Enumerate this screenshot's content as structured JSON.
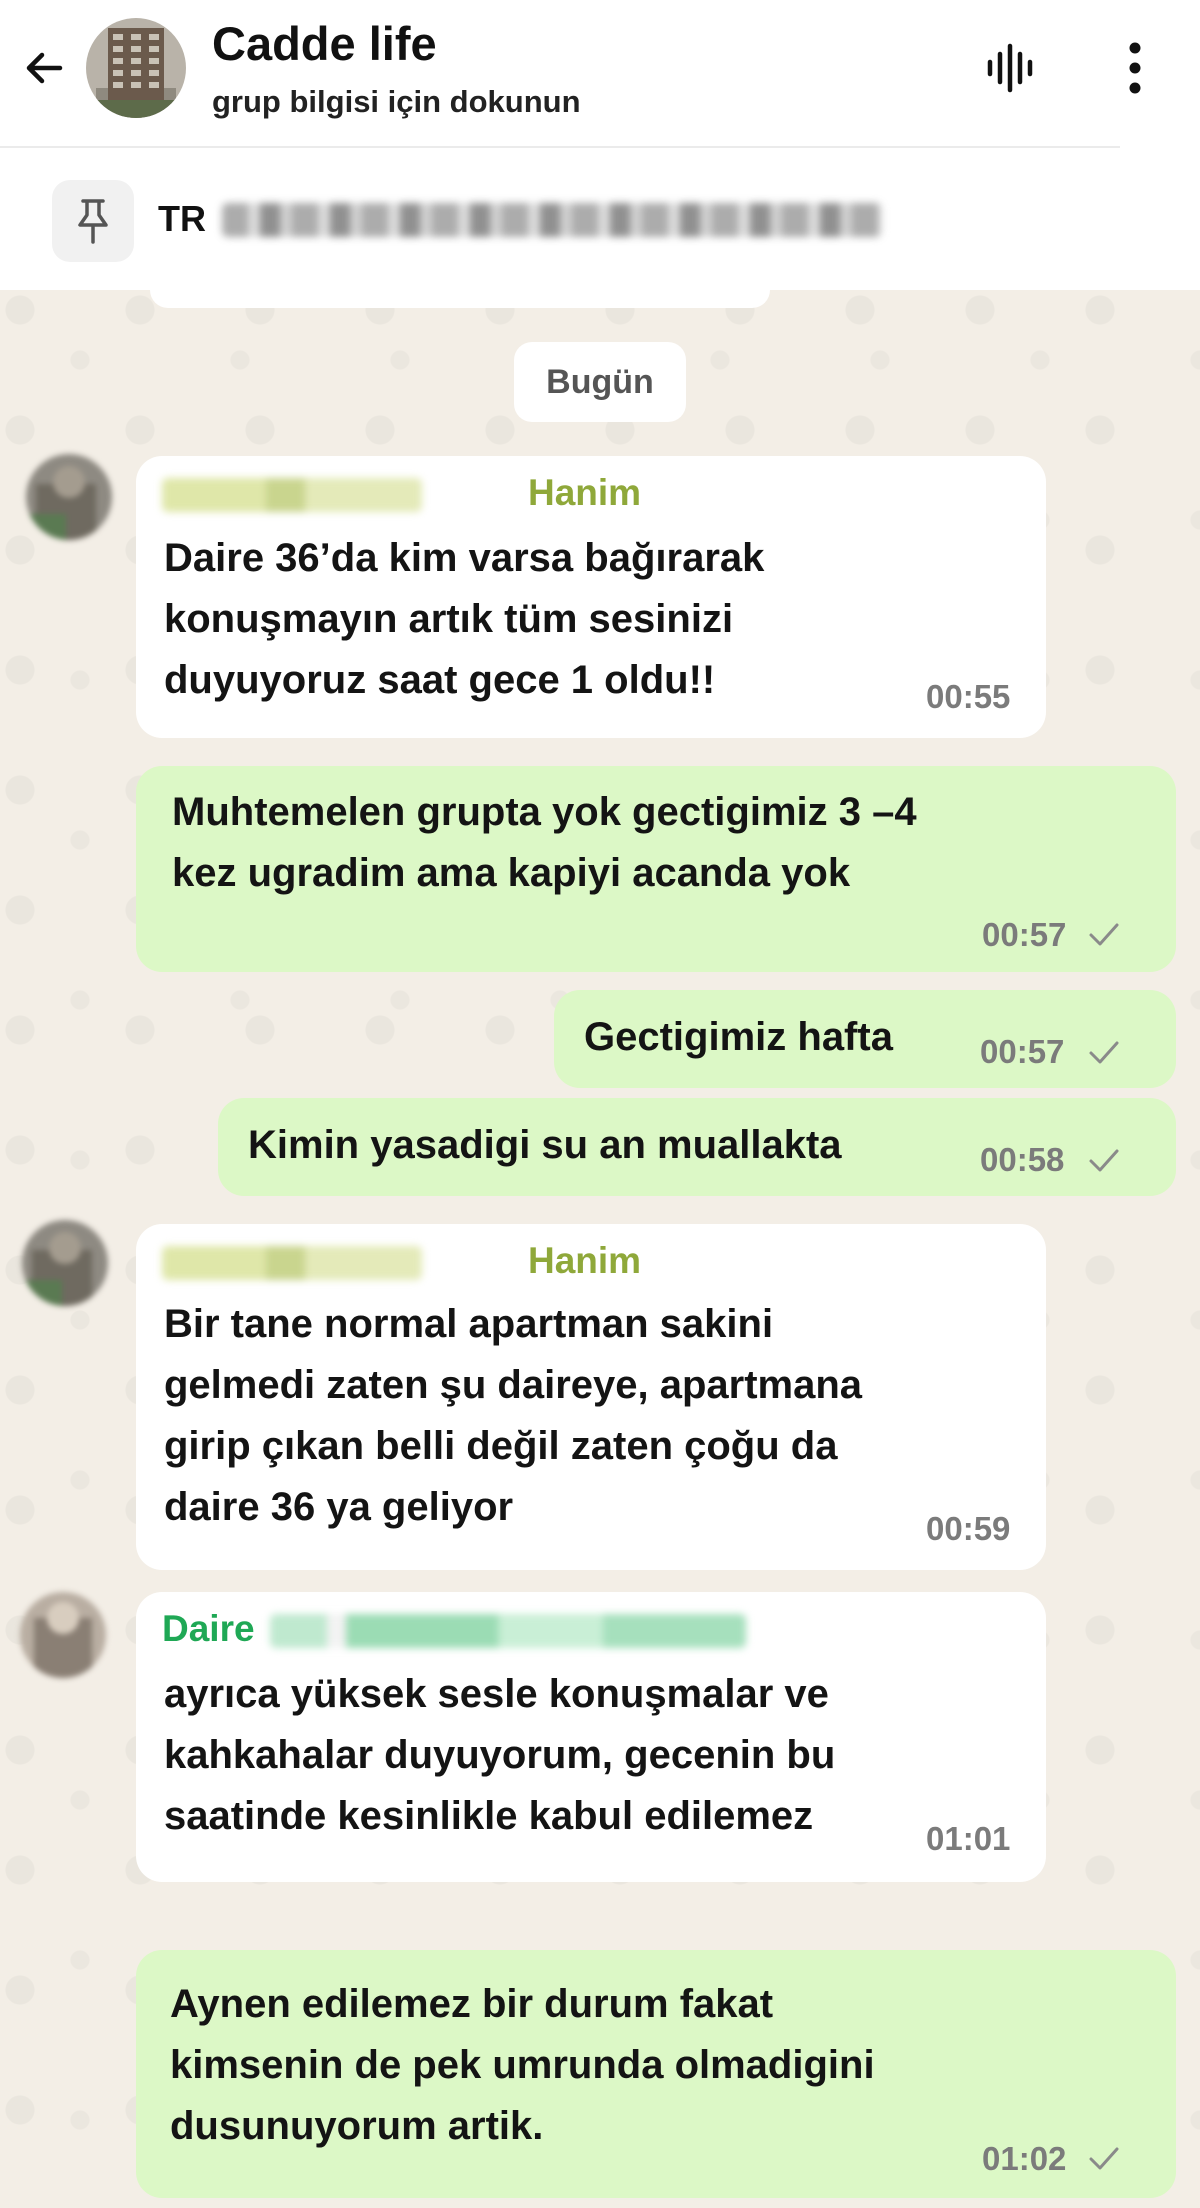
{
  "header": {
    "title": "Cadde life",
    "subtitle": "grup bilgisi için dokunun",
    "icons": [
      "back-arrow-icon",
      "group-avatar",
      "voice-call-icon",
      "more-vert-icon"
    ]
  },
  "pinned": {
    "text_prefix": "TR"
  },
  "chat": {
    "date_label": "Bugün",
    "messages": [
      {
        "direction": "in",
        "sender_suffix": "Hanim",
        "lines": [
          "Daire 36’da kim varsa bağırarak",
          "konuşmayın artık tüm sesinizi",
          "duyuyoruz saat gece 1 oldu!!"
        ],
        "time": "00:55"
      },
      {
        "direction": "out",
        "lines": [
          "Muhtemelen grupta yok gectigimiz 3 –4",
          "kez ugradim ama kapiyi acanda yok"
        ],
        "time": "00:57"
      },
      {
        "direction": "out",
        "lines": [
          "Gectigimiz hafta"
        ],
        "time": "00:57"
      },
      {
        "direction": "out",
        "lines": [
          "Kimin yasadigi su an muallakta"
        ],
        "time": "00:58"
      },
      {
        "direction": "in",
        "sender_suffix": "Hanim",
        "lines": [
          "Bir tane normal apartman sakini",
          "gelmedi zaten şu daireye, apartmana",
          "girip çıkan belli değil zaten çoğu da",
          "daire 36 ya geliyor"
        ],
        "time": "00:59"
      },
      {
        "direction": "in",
        "sender_prefix": "Daire",
        "lines": [
          "ayrıca yüksek sesle konuşmalar ve",
          "kahkahalar duyuyorum, gecenin bu",
          "saatinde kesinlikle kabul edilemez"
        ],
        "time": "01:01"
      },
      {
        "direction": "out",
        "lines": [
          "Aynen edilemez bir durum fakat",
          "kimsenin de pek umrunda olmadigini",
          "dusunuyorum artik."
        ],
        "time": "01:02"
      }
    ]
  },
  "colors": {
    "incoming_bubble": "#ffffff",
    "outgoing_bubble": "#dcf8c6",
    "sender_name_olive": "#8fa83a",
    "sender_name_green": "#1fa855",
    "chat_background": "#f3eee6"
  }
}
